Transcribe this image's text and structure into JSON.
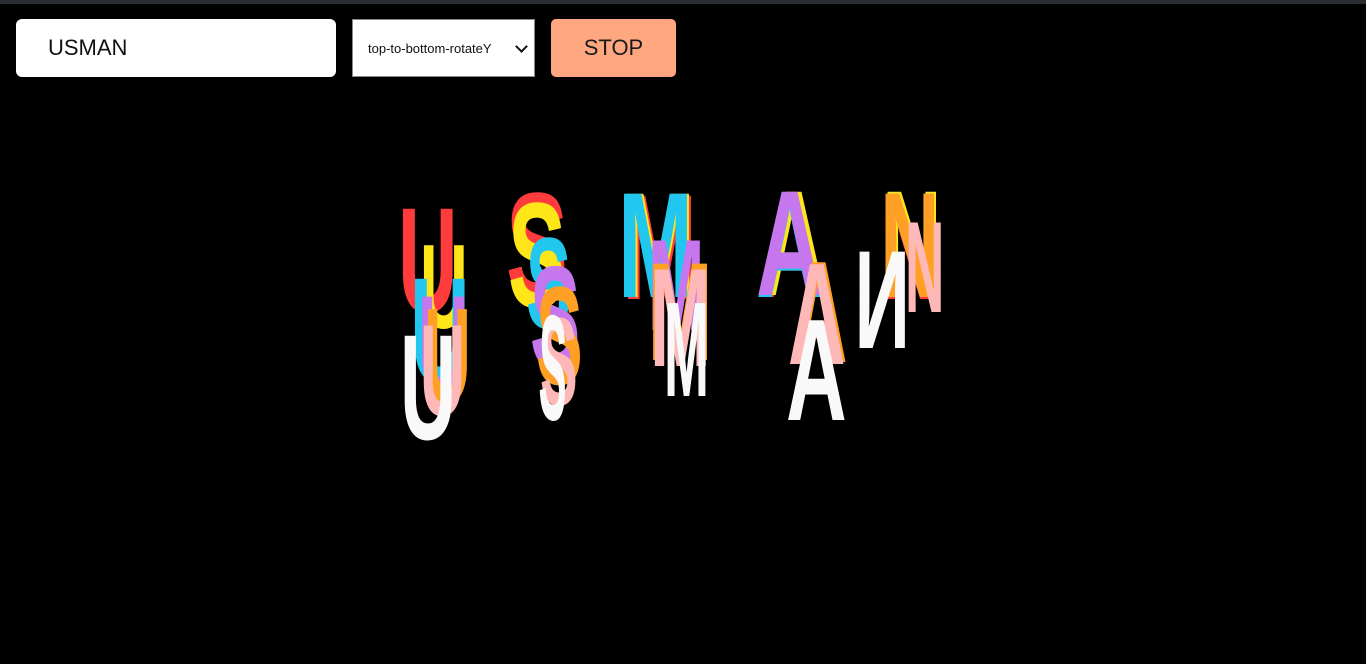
{
  "input": {
    "value": "USMAN"
  },
  "select": {
    "selected": "top-to-bottom-rotateY"
  },
  "button": {
    "label": "STOP"
  },
  "animation": {
    "palette": [
      "#ff3b3b",
      "#ffe619",
      "#22c7f0",
      "#c677ee",
      "#ffa024",
      "#ffb8b8",
      "#f9f9f9"
    ],
    "layers": [
      {
        "text": [
          "U",
          "S",
          "M",
          "A",
          "N"
        ],
        "color": "#ff3b3b"
      },
      {
        "text": [
          "U",
          "S",
          "M",
          "A",
          "N"
        ],
        "color": "#ffe619"
      },
      {
        "text": [
          "U",
          "S",
          "M",
          "A",
          "N"
        ],
        "color": "#22c7f0"
      },
      {
        "text": [
          "U",
          "S",
          "M",
          "A",
          "N"
        ],
        "color": "#c677ee"
      },
      {
        "text": [
          "U",
          "S",
          "M",
          "A",
          "N"
        ],
        "color": "#ffa024"
      },
      {
        "text": [
          "U",
          "S",
          "M",
          "A",
          "N"
        ],
        "color": "#ffb8b8"
      },
      {
        "text": [
          "U",
          "S",
          "M",
          "A",
          "N"
        ],
        "color": "#f9f9f9"
      }
    ]
  }
}
